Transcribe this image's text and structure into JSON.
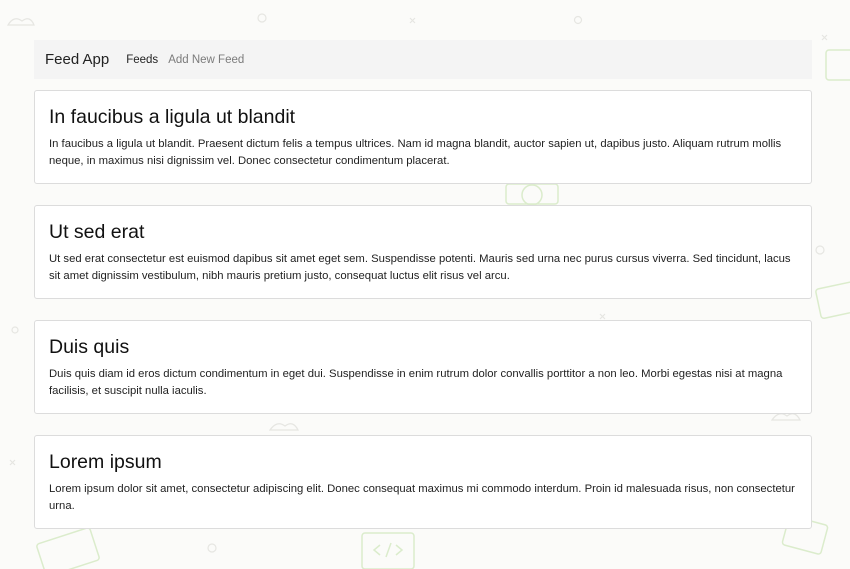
{
  "navbar": {
    "brand": "Feed App",
    "links": [
      {
        "label": "Feeds",
        "active": true
      },
      {
        "label": "Add New Feed",
        "active": false
      }
    ]
  },
  "feeds": [
    {
      "title": "In faucibus a ligula ut blandit",
      "body": "In faucibus a ligula ut blandit. Praesent dictum felis a tempus ultrices. Nam id magna blandit, auctor sapien ut, dapibus justo. Aliquam rutrum mollis neque, in maximus nisi dignissim vel. Donec consectetur condimentum placerat."
    },
    {
      "title": "Ut sed erat",
      "body": "Ut sed erat consectetur est euismod dapibus sit amet eget sem. Suspendisse potenti. Mauris sed urna nec purus cursus viverra. Sed tincidunt, lacus sit amet dignissim vestibulum, nibh mauris pretium justo, consequat luctus elit risus vel arcu."
    },
    {
      "title": "Duis quis",
      "body": "Duis quis diam id eros dictum condimentum in eget dui. Suspendisse in enim rutrum dolor convallis porttitor a non leo. Morbi egestas nisi at magna facilisis, et suscipit nulla iaculis."
    },
    {
      "title": "Lorem ipsum",
      "body": "Lorem ipsum dolor sit amet, consectetur adipiscing elit. Donec consequat maximus mi commodo interdum. Proin id malesuada risus, non consectetur urna."
    }
  ],
  "colors": {
    "background": "#fbfbf9",
    "navbar": "#f4f4f4",
    "decoration": "#cfe5b8"
  }
}
